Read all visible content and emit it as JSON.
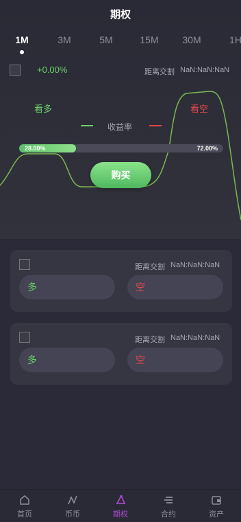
{
  "header": {
    "title": "期权"
  },
  "tabs": [
    {
      "label": "1M",
      "active": true
    },
    {
      "label": "3M"
    },
    {
      "label": "5M"
    },
    {
      "label": "15M"
    },
    {
      "label": "30M"
    },
    {
      "label": "1H"
    }
  ],
  "summary": {
    "change": "+0.00%",
    "settle_label": "距离交割",
    "settle_value": "NaN:NaN:NaN"
  },
  "chart": {
    "bull_label": "看多",
    "bear_label": "看空",
    "legend_label": "收益率",
    "bull_color": "#6ad06a",
    "bear_color": "#e04848",
    "bull_ratio_text": "28.00%",
    "bear_ratio_text": "72.00%",
    "bull_ratio": 0.28
  },
  "buy_button": {
    "label": "购买"
  },
  "cards": [
    {
      "settle_label": "距离交割",
      "settle_value": "NaN:NaN:NaN",
      "long_label": "多",
      "short_label": "空"
    },
    {
      "settle_label": "距离交割",
      "settle_value": "NaN:NaN:NaN",
      "long_label": "多",
      "short_label": "空"
    }
  ],
  "nav": [
    {
      "label": "首页",
      "icon": "home-icon"
    },
    {
      "label": "币币",
      "icon": "exchange-icon"
    },
    {
      "label": "期权",
      "icon": "options-icon",
      "active": true
    },
    {
      "label": "合约",
      "icon": "contract-icon"
    },
    {
      "label": "资产",
      "icon": "wallet-icon"
    }
  ],
  "accent_color": "#b04cd6"
}
